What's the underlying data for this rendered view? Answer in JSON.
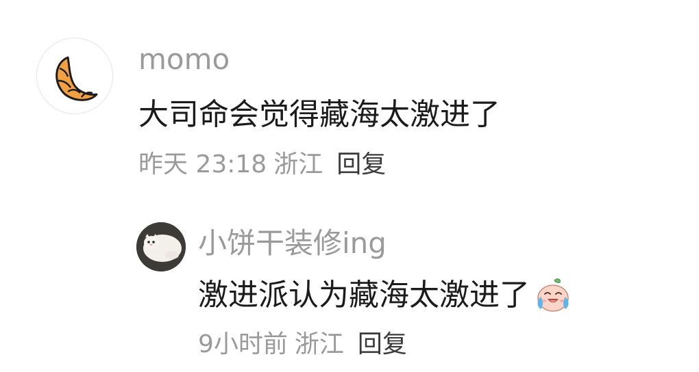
{
  "comment": {
    "avatar_icon": "croissant-icon",
    "username": "momo",
    "text": "大司命会觉得藏海太激进了",
    "time": "昨天 23:18",
    "location": "浙江",
    "reply_label": "回复"
  },
  "reply": {
    "avatar_icon": "cat-avatar",
    "username": "小饼干装修ing",
    "text": "激进派认为藏海太激进了",
    "emoji_icon": "laugh-cry-emoji-icon",
    "time": "9小时前",
    "location": "浙江",
    "reply_label": "回复"
  },
  "colors": {
    "username": "#9a9a9a",
    "text": "#1b1b1b",
    "meta": "#9a9a9a",
    "reply_button": "#3a3a3a"
  }
}
